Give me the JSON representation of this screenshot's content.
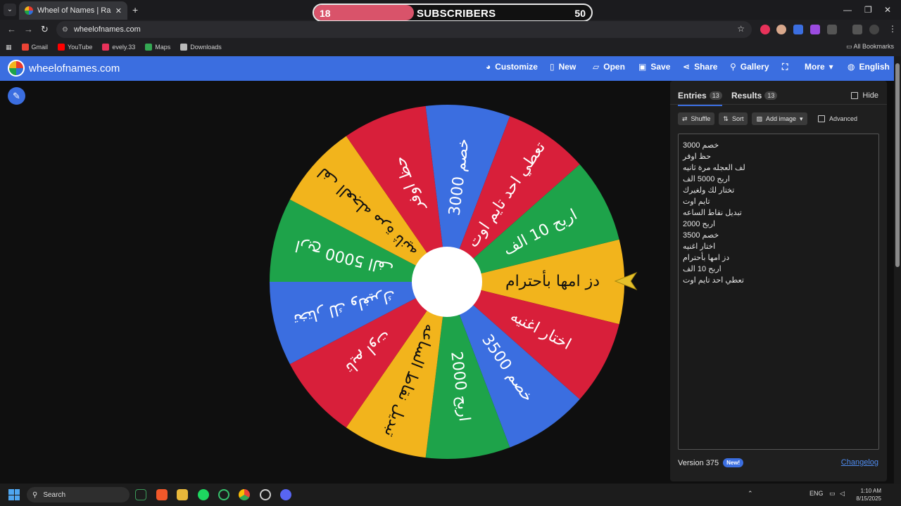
{
  "browser": {
    "tab_title": "Wheel of Names | Random nam",
    "url": "wheelofnames.com",
    "bookmarks": [
      {
        "label": "Gmail",
        "color": "#ea4335"
      },
      {
        "label": "YouTube",
        "color": "#ff0000"
      },
      {
        "label": "evely.33",
        "color": "#e8325a"
      },
      {
        "label": "Maps",
        "color": "#34a853"
      },
      {
        "label": "Downloads",
        "color": "#bbbbbb"
      }
    ],
    "all_bookmarks": "All Bookmarks"
  },
  "subscriber_bar": {
    "current": "18",
    "label": "SUBSCRIBERS",
    "goal": "50",
    "progress": 0.36
  },
  "app": {
    "logo_text": "wheelofnames.com",
    "menu": [
      {
        "label": "Customize",
        "icon": "palette-icon"
      },
      {
        "label": "New",
        "icon": "file-icon"
      },
      {
        "label": "Open",
        "icon": "folder-icon"
      },
      {
        "label": "Save",
        "icon": "save-icon"
      },
      {
        "label": "Share",
        "icon": "share-icon"
      },
      {
        "label": "Gallery",
        "icon": "search-icon"
      },
      {
        "label": "",
        "icon": "fullscreen-icon"
      },
      {
        "label": "More",
        "icon": "caret-down-icon"
      },
      {
        "label": "English",
        "icon": "globe-icon"
      }
    ],
    "accent": "#3b6ee0"
  },
  "wheel": {
    "segments": [
      {
        "label": "دز امها بأحترام",
        "color": "#f2b41c"
      },
      {
        "label": "اختار اغنيه",
        "color": "#d81f3a"
      },
      {
        "label": "خصم 3500",
        "color": "#3b6ee0"
      },
      {
        "label": "اربح 2000",
        "color": "#1ea34a"
      },
      {
        "label": "تبديل نقاط الساعه",
        "color": "#f2b41c"
      },
      {
        "label": "تايم اوت",
        "color": "#d81f3a"
      },
      {
        "label": "تختار لك ولغيرك",
        "color": "#3b6ee0"
      },
      {
        "label": "اربح 5000 الف",
        "color": "#1ea34a"
      },
      {
        "label": "لف العجله مرة ثانيه",
        "color": "#f2b41c"
      },
      {
        "label": "حظ اوفر",
        "color": "#d81f3a"
      },
      {
        "label": "خصم 3000",
        "color": "#3b6ee0"
      },
      {
        "label": "تعطي احد تايم اوت",
        "color": "#d81f3a"
      },
      {
        "label": "اربح 10 الف",
        "color": "#1ea34a"
      }
    ]
  },
  "sidebar": {
    "tabs": [
      {
        "label": "Entries",
        "count": "13"
      },
      {
        "label": "Results",
        "count": "13"
      }
    ],
    "hide_label": "Hide",
    "tools": [
      "Shuffle",
      "Sort",
      "Add image"
    ],
    "advanced_label": "Advanced",
    "entries": [
      "خصم 3000",
      "حظ اوفر",
      "لف العجله مرة ثانيه",
      "اربح 5000 الف",
      "تختار لك ولغيرك",
      "تايم اوت",
      "تبديل نقاط الساعه",
      "اربح 2000",
      "خصم 3500",
      "اختار اغنيه",
      "دز امها بأحترام",
      "اربح 10 الف",
      "تعطي احد تايم اوت"
    ],
    "version": "Version 375",
    "new_badge": "New!",
    "changelog": "Changelog"
  },
  "taskbar": {
    "search_label": "Search",
    "lang": "ENG",
    "time": "1:10 AM",
    "date": "8/15/2025"
  }
}
